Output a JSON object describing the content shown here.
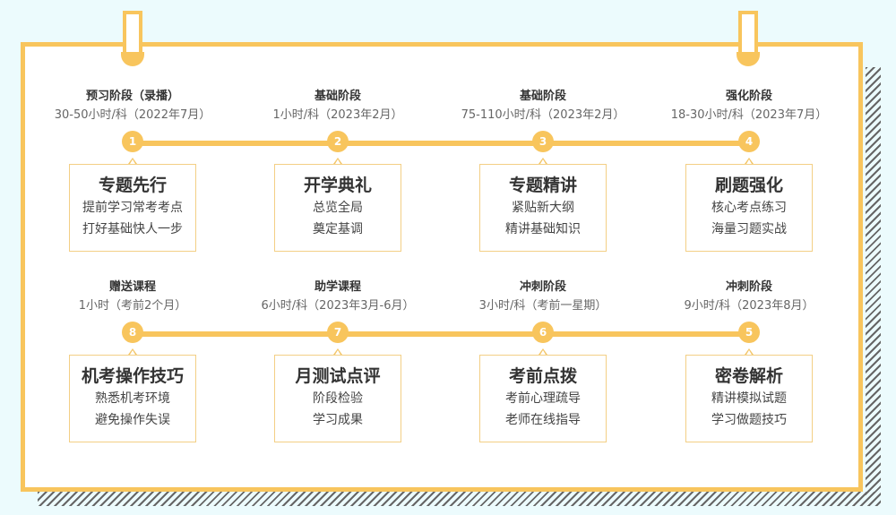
{
  "colors": {
    "accent": "#f8c55d",
    "background": "#ecfbfd"
  },
  "stages": [
    {
      "num": "1",
      "title": "预习阶段（录播）",
      "sub": "30-50小时/科（2022年7月）",
      "box_title": "专题先行",
      "lines": [
        "提前学习常考考点",
        "打好基础快人一步"
      ]
    },
    {
      "num": "2",
      "title": "基础阶段",
      "sub": "1小时/科（2023年2月）",
      "box_title": "开学典礼",
      "lines": [
        "总览全局",
        "奠定基调"
      ]
    },
    {
      "num": "3",
      "title": "基础阶段",
      "sub": "75-110小时/科（2023年2月）",
      "box_title": "专题精讲",
      "lines": [
        "紧贴新大纲",
        "精讲基础知识"
      ]
    },
    {
      "num": "4",
      "title": "强化阶段",
      "sub": "18-30小时/科（2023年7月）",
      "box_title": "刷题强化",
      "lines": [
        "核心考点练习",
        "海量习题实战"
      ]
    },
    {
      "num": "8",
      "title": "赠送课程",
      "sub": "1小时（考前2个月）",
      "box_title": "机考操作技巧",
      "lines": [
        "熟悉机考环境",
        "避免操作失误"
      ]
    },
    {
      "num": "7",
      "title": "助学课程",
      "sub": "6小时/科（2023年3月-6月）",
      "box_title": "月测试点评",
      "lines": [
        "阶段检验",
        "学习成果"
      ]
    },
    {
      "num": "6",
      "title": "冲刺阶段",
      "sub": "3小时/科（考前一星期）",
      "box_title": "考前点拨",
      "lines": [
        "考前心理疏导",
        "老师在线指导"
      ]
    },
    {
      "num": "5",
      "title": "冲刺阶段",
      "sub": "9小时/科（2023年8月）",
      "box_title": "密卷解析",
      "lines": [
        "精讲模拟试题",
        "学习做题技巧"
      ]
    }
  ]
}
